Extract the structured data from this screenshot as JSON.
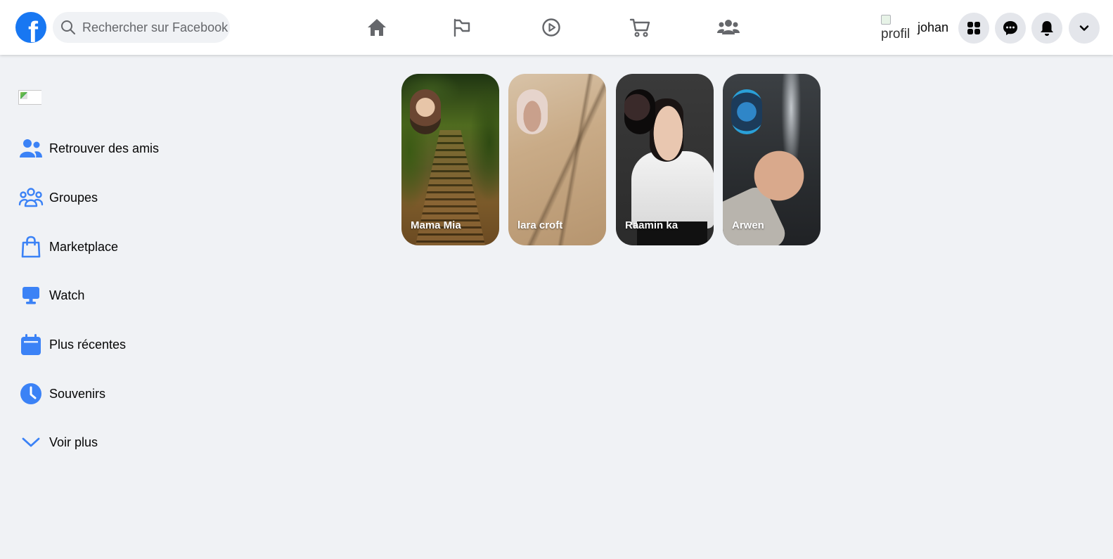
{
  "header": {
    "logo_letter": "f",
    "search_placeholder": "Rechercher sur Facebook",
    "nav_icons": [
      "home-icon",
      "flag-icon",
      "watch-icon",
      "marketplace-icon",
      "groups-icon"
    ],
    "profile_alt": "profil",
    "profile_name": "johan",
    "action_icons": [
      "menu-grid-icon",
      "messenger-icon",
      "notifications-icon",
      "account-chevron-icon"
    ],
    "accent_color": "#1877f2",
    "icon_color": "#65676b"
  },
  "sidebar": {
    "items": [
      {
        "label": "Retrouver des amis",
        "icon": "friends-icon"
      },
      {
        "label": "Groupes",
        "icon": "groups-icon"
      },
      {
        "label": "Marketplace",
        "icon": "shopping-bag-icon"
      },
      {
        "label": "Watch",
        "icon": "monitor-icon"
      },
      {
        "label": "Plus récentes",
        "icon": "calendar-icon"
      },
      {
        "label": "Souvenirs",
        "icon": "clock-icon"
      },
      {
        "label": "Voir plus",
        "icon": "chevron-down-icon"
      }
    ],
    "icon_color": "#3b82f6"
  },
  "stories": [
    {
      "name": "Mama Mia"
    },
    {
      "name": "lara croft"
    },
    {
      "name": "Raamin ka"
    },
    {
      "name": "Arwen"
    }
  ]
}
